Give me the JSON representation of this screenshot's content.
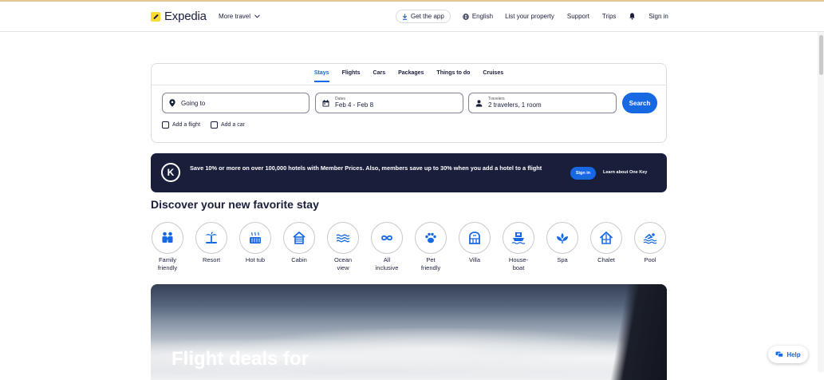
{
  "header": {
    "brand": "Expedia",
    "more_travel": "More travel",
    "get_app": "Get the app",
    "language": "English",
    "list_property": "List your property",
    "support": "Support",
    "trips": "Trips",
    "sign_in": "Sign in"
  },
  "search": {
    "tabs": [
      {
        "label": "Stays",
        "active": true
      },
      {
        "label": "Flights",
        "active": false
      },
      {
        "label": "Cars",
        "active": false
      },
      {
        "label": "Packages",
        "active": false
      },
      {
        "label": "Things to do",
        "active": false
      },
      {
        "label": "Cruises",
        "active": false
      }
    ],
    "going_to": {
      "placeholder": "Going to"
    },
    "dates": {
      "label": "Dates",
      "value": "Feb 4 - Feb 8"
    },
    "travelers": {
      "label": "Travelers",
      "value": "2 travelers, 1 room"
    },
    "search_button": "Search",
    "add_flight": "Add a flight",
    "add_car": "Add a car"
  },
  "banner": {
    "badge": "K",
    "text": "Save 10% or more on over 100,000 hotels with Member Prices. Also, members save up to 30% when you add a hotel to a flight",
    "sign_in": "Sign in",
    "learn": "Learn about One Key"
  },
  "discover": {
    "title": "Discover your new favorite stay",
    "categories": [
      {
        "label": "Family\nfriendly",
        "icon": "family-icon"
      },
      {
        "label": "Resort",
        "icon": "palm-tree-icon"
      },
      {
        "label": "Hot tub",
        "icon": "hot-tub-icon"
      },
      {
        "label": "Cabin",
        "icon": "cabin-icon"
      },
      {
        "label": "Ocean\nview",
        "icon": "waves-icon"
      },
      {
        "label": "All\ninclusive",
        "icon": "infinity-icon"
      },
      {
        "label": "Pet\nfriendly",
        "icon": "paw-icon"
      },
      {
        "label": "Villa",
        "icon": "villa-icon"
      },
      {
        "label": "House-\nboat",
        "icon": "houseboat-icon"
      },
      {
        "label": "Spa",
        "icon": "lotus-icon"
      },
      {
        "label": "Chalet",
        "icon": "chalet-icon"
      },
      {
        "label": "Pool",
        "icon": "swimmer-icon"
      }
    ]
  },
  "hero": {
    "title": "Flight deals for"
  },
  "help": {
    "label": "Help"
  },
  "colors": {
    "accent": "#1668e3",
    "navy": "#191e3b",
    "brand_yellow": "#fddb32"
  }
}
